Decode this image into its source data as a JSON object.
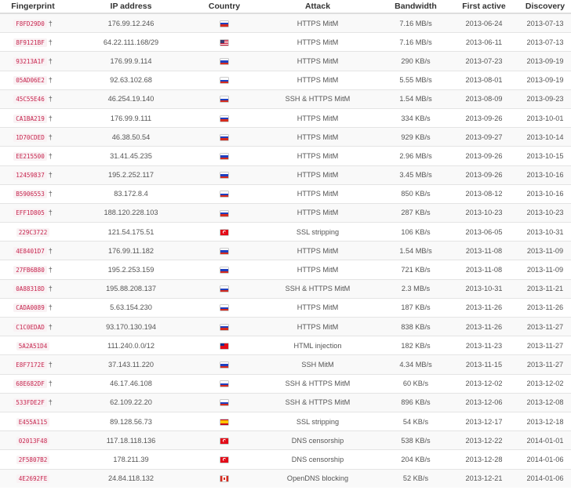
{
  "headers": [
    "Fingerprint",
    "IP address",
    "Country",
    "Attack",
    "Bandwidth",
    "First active",
    "Discovery"
  ],
  "rows": [
    {
      "fp": "F8FD29D0",
      "dagger": true,
      "ip": "176.99.12.246",
      "country": "ru",
      "attack": "HTTPS MitM",
      "bw": "7.16 MB/s",
      "first": "2013-06-24",
      "disc": "2013-07-13"
    },
    {
      "fp": "8F9121BF",
      "dagger": true,
      "ip": "64.22.111.168/29",
      "country": "us",
      "attack": "HTTPS MitM",
      "bw": "7.16 MB/s",
      "first": "2013-06-11",
      "disc": "2013-07-13"
    },
    {
      "fp": "93213A1F",
      "dagger": true,
      "ip": "176.99.9.114",
      "country": "ru",
      "attack": "HTTPS MitM",
      "bw": "290 KB/s",
      "first": "2013-07-23",
      "disc": "2013-09-19"
    },
    {
      "fp": "05AD06E2",
      "dagger": true,
      "ip": "92.63.102.68",
      "country": "ru",
      "attack": "HTTPS MitM",
      "bw": "5.55 MB/s",
      "first": "2013-08-01",
      "disc": "2013-09-19"
    },
    {
      "fp": "45C55E46",
      "dagger": true,
      "ip": "46.254.19.140",
      "country": "ru",
      "attack": "SSH & HTTPS MitM",
      "bw": "1.54 MB/s",
      "first": "2013-08-09",
      "disc": "2013-09-23"
    },
    {
      "fp": "CA1BA219",
      "dagger": true,
      "ip": "176.99.9.111",
      "country": "ru",
      "attack": "HTTPS MitM",
      "bw": "334 KB/s",
      "first": "2013-09-26",
      "disc": "2013-10-01"
    },
    {
      "fp": "1D70CDED",
      "dagger": true,
      "ip": "46.38.50.54",
      "country": "ru",
      "attack": "HTTPS MitM",
      "bw": "929 KB/s",
      "first": "2013-09-27",
      "disc": "2013-10-14"
    },
    {
      "fp": "EE215500",
      "dagger": true,
      "ip": "31.41.45.235",
      "country": "ru",
      "attack": "HTTPS MitM",
      "bw": "2.96 MB/s",
      "first": "2013-09-26",
      "disc": "2013-10-15"
    },
    {
      "fp": "12459837",
      "dagger": true,
      "ip": "195.2.252.117",
      "country": "ru",
      "attack": "HTTPS MitM",
      "bw": "3.45 MB/s",
      "first": "2013-09-26",
      "disc": "2013-10-16"
    },
    {
      "fp": "B5906553",
      "dagger": true,
      "ip": "83.172.8.4",
      "country": "ru",
      "attack": "HTTPS MitM",
      "bw": "850 KB/s",
      "first": "2013-08-12",
      "disc": "2013-10-16"
    },
    {
      "fp": "EFF1D805",
      "dagger": true,
      "ip": "188.120.228.103",
      "country": "ru",
      "attack": "HTTPS MitM",
      "bw": "287 KB/s",
      "first": "2013-10-23",
      "disc": "2013-10-23"
    },
    {
      "fp": "229C3722",
      "dagger": false,
      "ip": "121.54.175.51",
      "country": "tr",
      "attack": "SSL stripping",
      "bw": "106 KB/s",
      "first": "2013-06-05",
      "disc": "2013-10-31"
    },
    {
      "fp": "4E8401D7",
      "dagger": true,
      "ip": "176.99.11.182",
      "country": "ru",
      "attack": "HTTPS MitM",
      "bw": "1.54 MB/s",
      "first": "2013-11-08",
      "disc": "2013-11-09"
    },
    {
      "fp": "27FB6B80",
      "dagger": true,
      "ip": "195.2.253.159",
      "country": "ru",
      "attack": "HTTPS MitM",
      "bw": "721 KB/s",
      "first": "2013-11-08",
      "disc": "2013-11-09"
    },
    {
      "fp": "0A88318D",
      "dagger": true,
      "ip": "195.88.208.137",
      "country": "ru",
      "attack": "SSH & HTTPS MitM",
      "bw": "2.3 MB/s",
      "first": "2013-10-31",
      "disc": "2013-11-21"
    },
    {
      "fp": "CADA0089",
      "dagger": true,
      "ip": "5.63.154.230",
      "country": "ru",
      "attack": "HTTPS MitM",
      "bw": "187 KB/s",
      "first": "2013-11-26",
      "disc": "2013-11-26"
    },
    {
      "fp": "C1C0EDAD",
      "dagger": true,
      "ip": "93.170.130.194",
      "country": "ru",
      "attack": "HTTPS MitM",
      "bw": "838 KB/s",
      "first": "2013-11-26",
      "disc": "2013-11-27"
    },
    {
      "fp": "5A2A51D4",
      "dagger": false,
      "ip": "111.240.0.0/12",
      "country": "tw",
      "attack": "HTML injection",
      "bw": "182 KB/s",
      "first": "2013-11-23",
      "disc": "2013-11-27"
    },
    {
      "fp": "E8F7172E",
      "dagger": true,
      "ip": "37.143.11.220",
      "country": "ru",
      "attack": "SSH MitM",
      "bw": "4.34 MB/s",
      "first": "2013-11-15",
      "disc": "2013-11-27"
    },
    {
      "fp": "68E682DF",
      "dagger": true,
      "ip": "46.17.46.108",
      "country": "ru",
      "attack": "SSH & HTTPS MitM",
      "bw": "60 KB/s",
      "first": "2013-12-02",
      "disc": "2013-12-02"
    },
    {
      "fp": "533FDE2F",
      "dagger": true,
      "ip": "62.109.22.20",
      "country": "ru",
      "attack": "SSH & HTTPS MitM",
      "bw": "896 KB/s",
      "first": "2013-12-06",
      "disc": "2013-12-08"
    },
    {
      "fp": "E455A115",
      "dagger": false,
      "ip": "89.128.56.73",
      "country": "es",
      "attack": "SSL stripping",
      "bw": "54 KB/s",
      "first": "2013-12-17",
      "disc": "2013-12-18"
    },
    {
      "fp": "02013F48",
      "dagger": false,
      "ip": "117.18.118.136",
      "country": "tr",
      "attack": "DNS censorship",
      "bw": "538 KB/s",
      "first": "2013-12-22",
      "disc": "2014-01-01"
    },
    {
      "fp": "2F5807B2",
      "dagger": false,
      "ip": "178.211.39",
      "country": "tr",
      "attack": "DNS censorship",
      "bw": "204 KB/s",
      "first": "2013-12-28",
      "disc": "2014-01-06"
    },
    {
      "fp": "4E2692FE",
      "dagger": false,
      "ip": "24.84.118.132",
      "country": "ca",
      "attack": "OpenDNS blocking",
      "bw": "52 KB/s",
      "first": "2013-12-21",
      "disc": "2014-01-06"
    }
  ],
  "icons": {
    "ru": "flag-russia-icon",
    "us": "flag-usa-icon",
    "tr": "flag-turkey-icon",
    "tw": "flag-taiwan-icon",
    "es": "flag-spain-icon",
    "ca": "flag-canada-icon"
  }
}
